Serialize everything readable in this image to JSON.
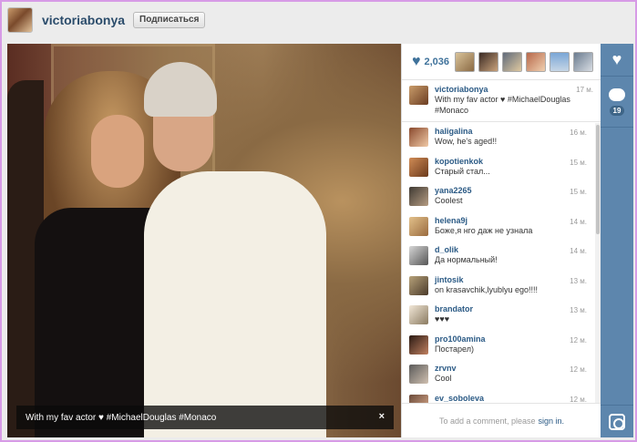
{
  "header": {
    "username": "victoriabonya",
    "follow_label": "Подписаться"
  },
  "photo": {
    "caption": "With my fav actor ♥ #MichaelDouglas #Monaco",
    "close_label": "×"
  },
  "likes": {
    "count": "2,036",
    "heart_icon": "heart-icon"
  },
  "post": {
    "username": "victoriabonya",
    "time": "17 м.",
    "text": "With my fav actor ♥ #MichaelDouglas #Monaco"
  },
  "comments": [
    {
      "user": "haligalina",
      "text": "Wow, he's aged!!",
      "time": "16 м."
    },
    {
      "user": "kopotienkok",
      "text": "Старый стал...",
      "time": "15 м."
    },
    {
      "user": "yana2265",
      "text": "Coolest",
      "time": "15 м."
    },
    {
      "user": "helena9j",
      "text": "Боже,я нго даж не узнала",
      "time": "14 м."
    },
    {
      "user": "d_olik",
      "text": "Да нормальный!",
      "time": "14 м."
    },
    {
      "user": "jintosik",
      "text": "on krasavchik,lyublyu ego!!!!",
      "time": "13 м."
    },
    {
      "user": "brandator",
      "text": "♥♥♥",
      "time": "13 м."
    },
    {
      "user": "pro100amina",
      "text": "Постарел)",
      "time": "12 м."
    },
    {
      "user": "zrvnv",
      "text": "Cool",
      "time": "12 м."
    },
    {
      "user": "ev_soboleva",
      "text": "",
      "time": "12 м."
    }
  ],
  "add_comment": {
    "prefix": "To add a comment, please",
    "link": "sign in."
  },
  "strip": {
    "comments_count": "19"
  },
  "colors": {
    "accent": "#3f729b",
    "strip": "#5d86ad",
    "username": "#2b5a85"
  }
}
